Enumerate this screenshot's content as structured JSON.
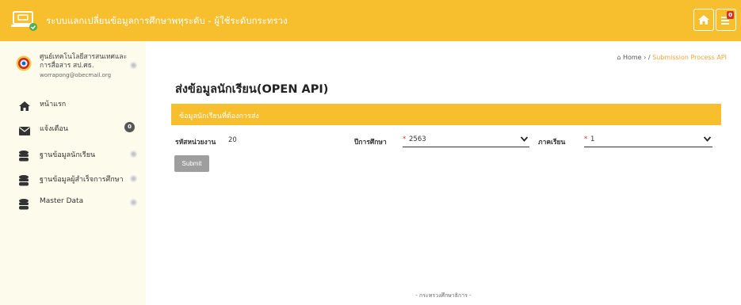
{
  "header": {
    "app_title": "ระบบแลกเปลี่ยนข้อมูลการศึกษาพหุระดับ - ผู้ใช้ระดับกระทรวง",
    "notification_count": "0",
    "logo_icon": "laptop-check-icon",
    "home_icon": "home-icon",
    "notify_icon": "notification-list-icon",
    "accent_color": "#f7be2e"
  },
  "sidebar": {
    "profile": {
      "name": "ศูนย์เทคโนโลยีสารสนเทศและการสื่อสาร สป.ศธ.",
      "email": "worrapong@obecmail.org"
    },
    "items": [
      {
        "label": "หน้าแรก",
        "icon": "home-icon"
      },
      {
        "label": "แจ้งเตือน",
        "icon": "envelope-icon",
        "badge": "0"
      },
      {
        "label": "ฐานข้อมูลนักเรียน",
        "icon": "database-icon"
      },
      {
        "label": "ฐานข้อมูลผู้สำเร็จการศึกษา",
        "icon": "database-icon"
      },
      {
        "label": "Master Data",
        "icon": "database-icon"
      }
    ]
  },
  "breadcrumb": {
    "home": "Home",
    "separator": "/",
    "current": "Submission Process API"
  },
  "main": {
    "page_title": "ส่งข้อมูลนักเรียน(OPEN API)",
    "panel_title": "ข้อมูลนักเรียนที่ต้องการส่ง",
    "form": {
      "unit_code_label": "รหัสหน่วยงาน",
      "unit_code_value": "20",
      "academic_year_label": "ปีการศึกษา",
      "academic_year_value": "2563",
      "semester_label": "ภาคเรียน",
      "semester_value": "1",
      "required_mark": "*"
    },
    "submit_label": "Submit"
  },
  "footer": {
    "text": "- กระทรวงศึกษาธิการ -"
  }
}
